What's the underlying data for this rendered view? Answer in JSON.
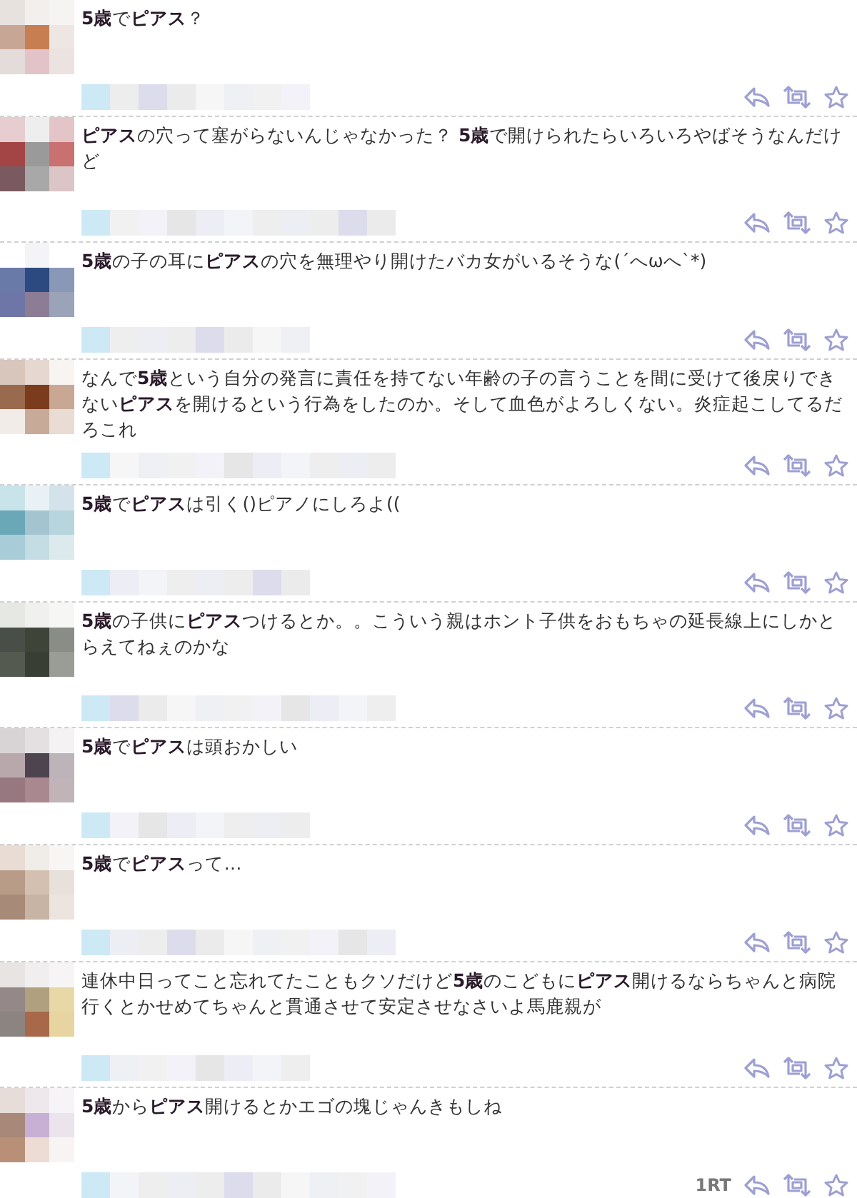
{
  "tweets": [
    {
      "text": "**5歳**で**ピアス**？"
    },
    {
      "text": "**ピアス**の穴って塞がらないんじゃなかった？ **5歳**で開けられたらいろいろやばそうなんだけど"
    },
    {
      "text": "**5歳**の子の耳に**ピアス**の穴を無理やり開けたバカ女がいるそうな(´へωへ`*)"
    },
    {
      "text": "なんで**5歳**という自分の発言に責任を持てない年齢の子の言うことを間に受けて後戻りできない**ピアス**を開けるという行為をしたのか。そして血色がよろしくない。炎症起こしてるだろこれ"
    },
    {
      "text": "**5歳**で**ピアス**は引く()ピアノにしろよ(("
    },
    {
      "text": "**5歳**の子供に**ピアス**つけるとか。。こういう親はホント子供をおもちゃの延長線上にしかとらえてねぇのかな"
    },
    {
      "text": "**5歳**で**ピアス**は頭おかしい"
    },
    {
      "text": "**5歳**で**ピアス**って…"
    },
    {
      "text": "連休中日ってこと忘れてたこともクソだけど**5歳**のこどもに**ピアス**開けるならちゃんと病院行くとかせめてちゃんと貫通させて安定させなさいよ馬鹿親が"
    },
    {
      "text": "**5歳**から**ピアス**開けるとかエゴの塊じゃんきもしね",
      "retweets": "1RT"
    }
  ]
}
